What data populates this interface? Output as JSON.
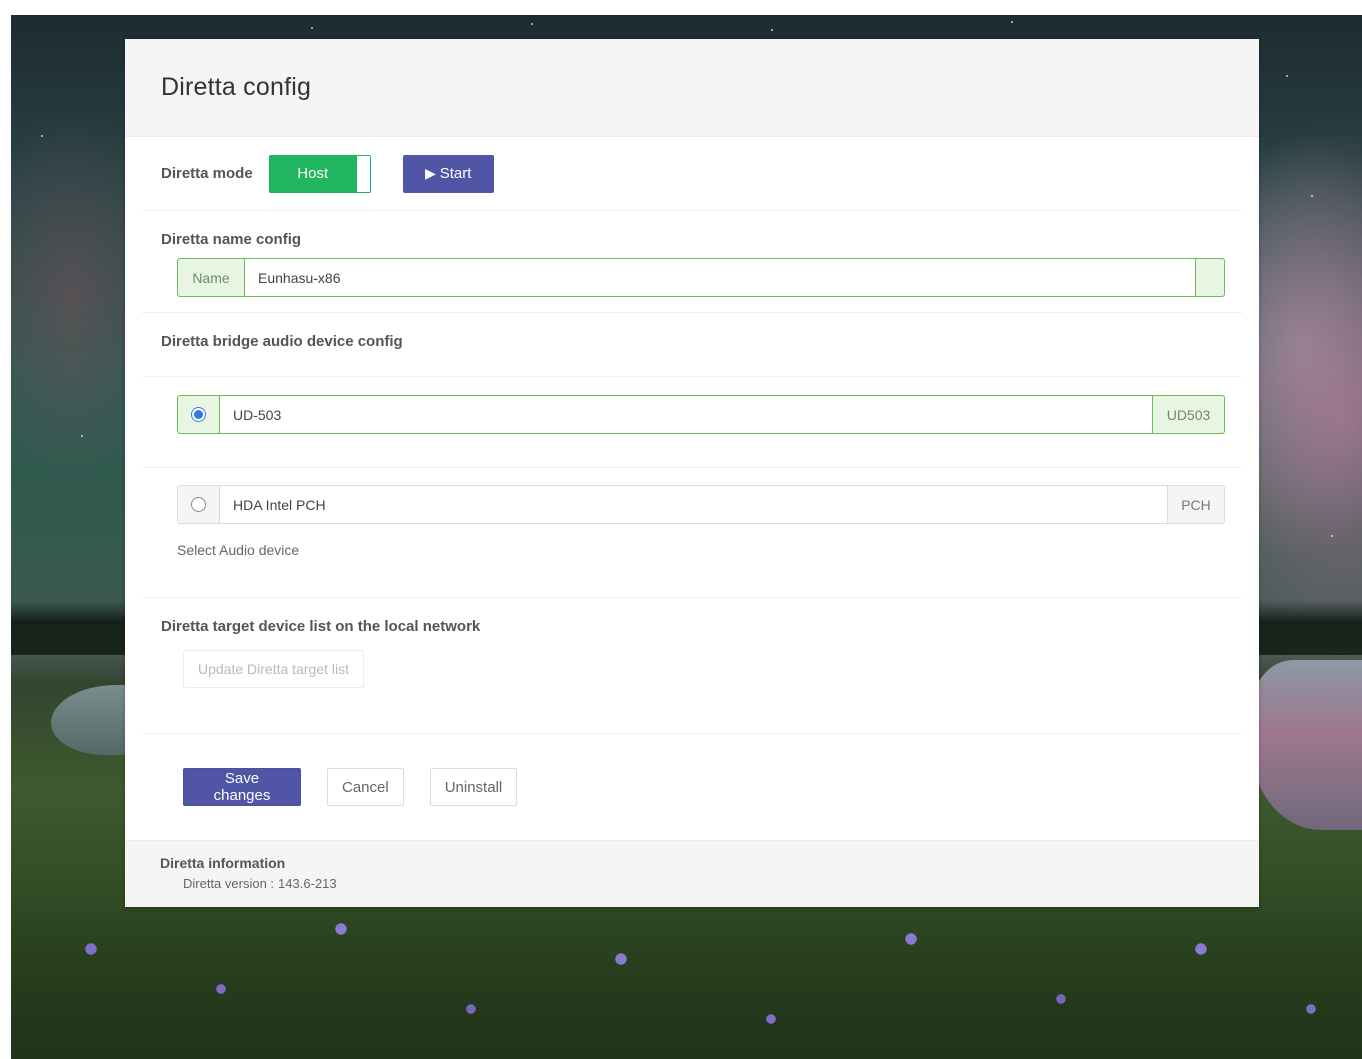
{
  "page": {
    "title": "Diretta config"
  },
  "mode": {
    "label": "Diretta mode",
    "toggle_label": "Host",
    "start_label": "Start",
    "start_icon": "play-icon"
  },
  "name_config": {
    "label": "Diretta name config",
    "addon": "Name",
    "value": "Eunhasu-x86"
  },
  "bridge": {
    "label": "Diretta bridge audio device config",
    "devices": [
      {
        "name": "UD-503",
        "code": "UD503",
        "selected": true
      },
      {
        "name": "HDA Intel PCH",
        "code": "PCH",
        "selected": false
      }
    ],
    "hint": "Select Audio device"
  },
  "target": {
    "label": "Diretta target device list on the local network",
    "update_button": "Update Diretta target list"
  },
  "actions": {
    "save": "Save changes",
    "cancel": "Cancel",
    "uninstall": "Uninstall"
  },
  "info": {
    "label": "Diretta information",
    "version_label": "Diretta version :",
    "version_value": "143.6-213"
  },
  "colors": {
    "accent": "#5055a6",
    "success": "#22b55f",
    "success_border": "#6bbd5a",
    "radio_selected": "#2f7ae5"
  }
}
